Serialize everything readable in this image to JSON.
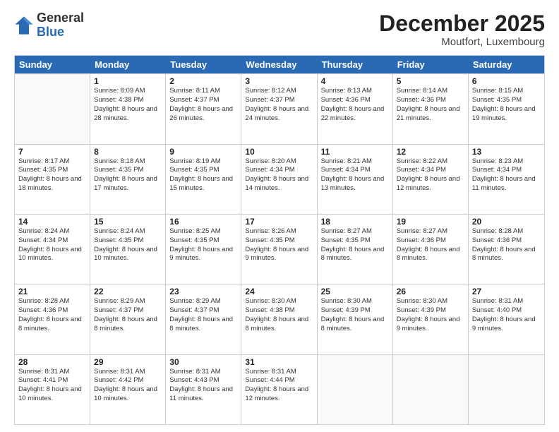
{
  "header": {
    "logo_general": "General",
    "logo_blue": "Blue",
    "month_title": "December 2025",
    "subtitle": "Moutfort, Luxembourg"
  },
  "days_of_week": [
    "Sunday",
    "Monday",
    "Tuesday",
    "Wednesday",
    "Thursday",
    "Friday",
    "Saturday"
  ],
  "weeks": [
    [
      {
        "day": "",
        "sunrise": "",
        "sunset": "",
        "daylight": "",
        "empty": true
      },
      {
        "day": "1",
        "sunrise": "8:09 AM",
        "sunset": "4:38 PM",
        "daylight": "8 hours and 28 minutes."
      },
      {
        "day": "2",
        "sunrise": "8:11 AM",
        "sunset": "4:37 PM",
        "daylight": "8 hours and 26 minutes."
      },
      {
        "day": "3",
        "sunrise": "8:12 AM",
        "sunset": "4:37 PM",
        "daylight": "8 hours and 24 minutes."
      },
      {
        "day": "4",
        "sunrise": "8:13 AM",
        "sunset": "4:36 PM",
        "daylight": "8 hours and 22 minutes."
      },
      {
        "day": "5",
        "sunrise": "8:14 AM",
        "sunset": "4:36 PM",
        "daylight": "8 hours and 21 minutes."
      },
      {
        "day": "6",
        "sunrise": "8:15 AM",
        "sunset": "4:35 PM",
        "daylight": "8 hours and 19 minutes."
      }
    ],
    [
      {
        "day": "7",
        "sunrise": "8:17 AM",
        "sunset": "4:35 PM",
        "daylight": "8 hours and 18 minutes."
      },
      {
        "day": "8",
        "sunrise": "8:18 AM",
        "sunset": "4:35 PM",
        "daylight": "8 hours and 17 minutes."
      },
      {
        "day": "9",
        "sunrise": "8:19 AM",
        "sunset": "4:35 PM",
        "daylight": "8 hours and 15 minutes."
      },
      {
        "day": "10",
        "sunrise": "8:20 AM",
        "sunset": "4:34 PM",
        "daylight": "8 hours and 14 minutes."
      },
      {
        "day": "11",
        "sunrise": "8:21 AM",
        "sunset": "4:34 PM",
        "daylight": "8 hours and 13 minutes."
      },
      {
        "day": "12",
        "sunrise": "8:22 AM",
        "sunset": "4:34 PM",
        "daylight": "8 hours and 12 minutes."
      },
      {
        "day": "13",
        "sunrise": "8:23 AM",
        "sunset": "4:34 PM",
        "daylight": "8 hours and 11 minutes."
      }
    ],
    [
      {
        "day": "14",
        "sunrise": "8:24 AM",
        "sunset": "4:34 PM",
        "daylight": "8 hours and 10 minutes."
      },
      {
        "day": "15",
        "sunrise": "8:24 AM",
        "sunset": "4:35 PM",
        "daylight": "8 hours and 10 minutes."
      },
      {
        "day": "16",
        "sunrise": "8:25 AM",
        "sunset": "4:35 PM",
        "daylight": "8 hours and 9 minutes."
      },
      {
        "day": "17",
        "sunrise": "8:26 AM",
        "sunset": "4:35 PM",
        "daylight": "8 hours and 9 minutes."
      },
      {
        "day": "18",
        "sunrise": "8:27 AM",
        "sunset": "4:35 PM",
        "daylight": "8 hours and 8 minutes."
      },
      {
        "day": "19",
        "sunrise": "8:27 AM",
        "sunset": "4:36 PM",
        "daylight": "8 hours and 8 minutes."
      },
      {
        "day": "20",
        "sunrise": "8:28 AM",
        "sunset": "4:36 PM",
        "daylight": "8 hours and 8 minutes."
      }
    ],
    [
      {
        "day": "21",
        "sunrise": "8:28 AM",
        "sunset": "4:36 PM",
        "daylight": "8 hours and 8 minutes."
      },
      {
        "day": "22",
        "sunrise": "8:29 AM",
        "sunset": "4:37 PM",
        "daylight": "8 hours and 8 minutes."
      },
      {
        "day": "23",
        "sunrise": "8:29 AM",
        "sunset": "4:37 PM",
        "daylight": "8 hours and 8 minutes."
      },
      {
        "day": "24",
        "sunrise": "8:30 AM",
        "sunset": "4:38 PM",
        "daylight": "8 hours and 8 minutes."
      },
      {
        "day": "25",
        "sunrise": "8:30 AM",
        "sunset": "4:39 PM",
        "daylight": "8 hours and 8 minutes."
      },
      {
        "day": "26",
        "sunrise": "8:30 AM",
        "sunset": "4:39 PM",
        "daylight": "8 hours and 9 minutes."
      },
      {
        "day": "27",
        "sunrise": "8:31 AM",
        "sunset": "4:40 PM",
        "daylight": "8 hours and 9 minutes."
      }
    ],
    [
      {
        "day": "28",
        "sunrise": "8:31 AM",
        "sunset": "4:41 PM",
        "daylight": "8 hours and 10 minutes."
      },
      {
        "day": "29",
        "sunrise": "8:31 AM",
        "sunset": "4:42 PM",
        "daylight": "8 hours and 10 minutes."
      },
      {
        "day": "30",
        "sunrise": "8:31 AM",
        "sunset": "4:43 PM",
        "daylight": "8 hours and 11 minutes."
      },
      {
        "day": "31",
        "sunrise": "8:31 AM",
        "sunset": "4:44 PM",
        "daylight": "8 hours and 12 minutes."
      },
      {
        "day": "",
        "sunrise": "",
        "sunset": "",
        "daylight": "",
        "empty": true
      },
      {
        "day": "",
        "sunrise": "",
        "sunset": "",
        "daylight": "",
        "empty": true
      },
      {
        "day": "",
        "sunrise": "",
        "sunset": "",
        "daylight": "",
        "empty": true
      }
    ]
  ]
}
